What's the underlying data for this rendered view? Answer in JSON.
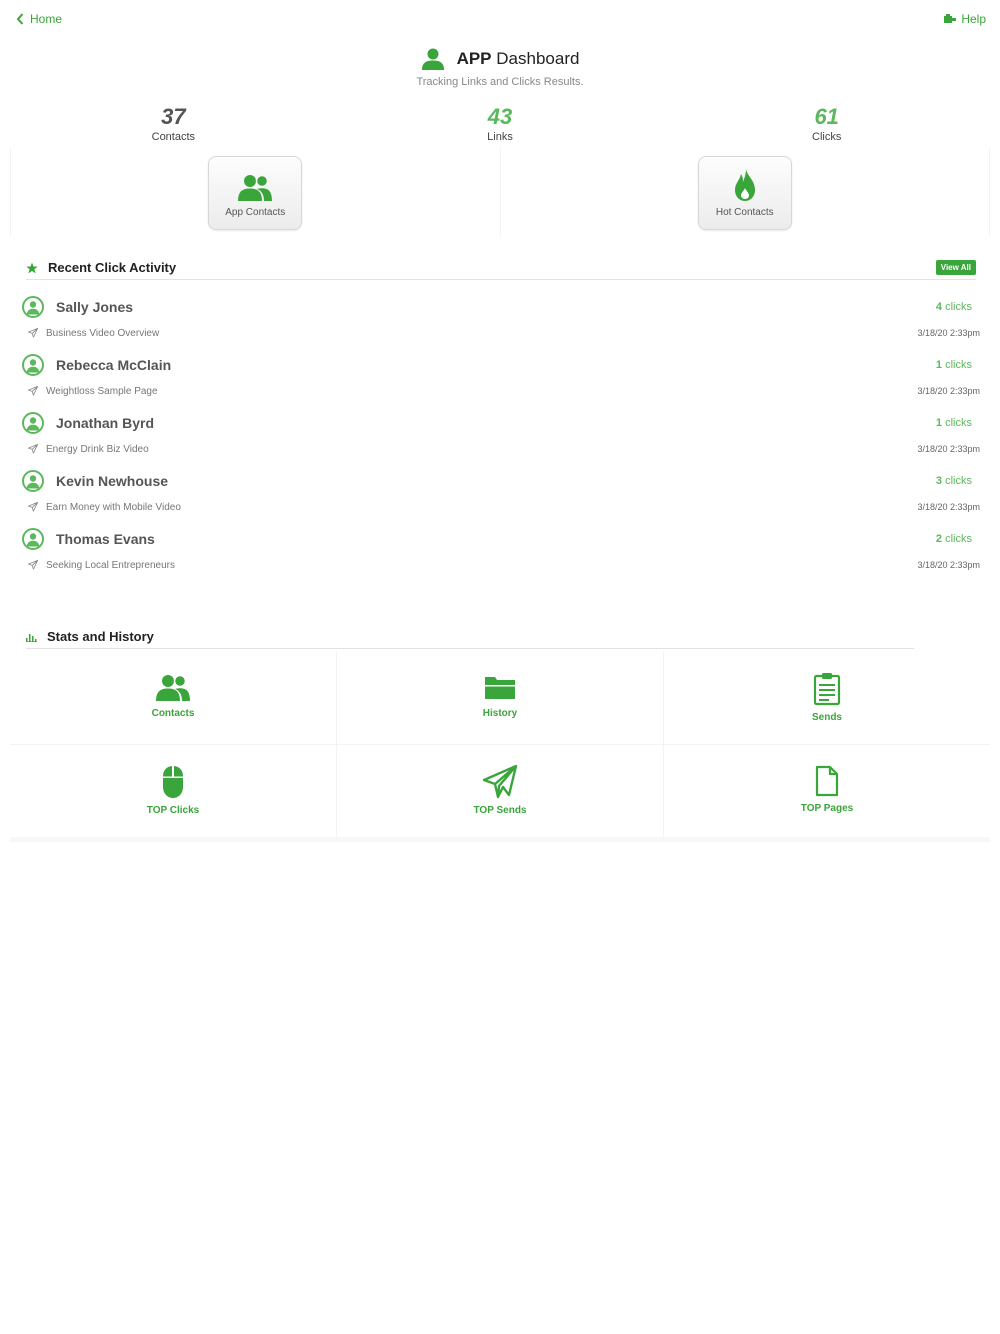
{
  "nav": {
    "back_label": "Home",
    "help_label": "Help"
  },
  "header": {
    "title_bold": "APP",
    "title_rest": "Dashboard",
    "subtitle": "Tracking Links and Clicks Results."
  },
  "counters": [
    {
      "value": "37",
      "label": "Contacts"
    },
    {
      "value": "43",
      "label": "Links"
    },
    {
      "value": "61",
      "label": "Clicks"
    }
  ],
  "actions": [
    {
      "label": "App Contacts",
      "icon": "users-icon"
    },
    {
      "label": "Hot Contacts",
      "icon": "flame-icon"
    }
  ],
  "recent": {
    "title": "Recent Click Activity",
    "view_all": "View All",
    "items": [
      {
        "name": "Sally Jones",
        "clicks": "4",
        "clicks_label": "clicks",
        "page": "Business Video Overview",
        "date": "3/18/20 2:33pm"
      },
      {
        "name": "Rebecca McClain",
        "clicks": "1",
        "clicks_label": "clicks",
        "page": "Weightloss Sample Page",
        "date": "3/18/20 2:33pm"
      },
      {
        "name": "Jonathan Byrd",
        "clicks": "1",
        "clicks_label": "clicks",
        "page": "Energy Drink Biz Video",
        "date": "3/18/20 2:33pm"
      },
      {
        "name": "Kevin Newhouse",
        "clicks": "3",
        "clicks_label": "clicks",
        "page": "Earn Money with Mobile Video",
        "date": "3/18/20 2:33pm"
      },
      {
        "name": "Thomas Evans",
        "clicks": "2",
        "clicks_label": "clicks",
        "page": "Seeking Local Entrepreneurs",
        "date": "3/18/20 2:33pm"
      }
    ]
  },
  "stats": {
    "title": "Stats and History",
    "tiles": [
      {
        "label": "Contacts",
        "icon": "users-icon"
      },
      {
        "label": "History",
        "icon": "folder-icon"
      },
      {
        "label": "Sends",
        "icon": "clipboard-icon"
      },
      {
        "label": "TOP Clicks",
        "icon": "mouse-icon"
      },
      {
        "label": "TOP Sends",
        "icon": "paper-plane-icon"
      },
      {
        "label": "TOP Pages",
        "icon": "file-icon"
      }
    ]
  },
  "colors": {
    "accent": "#3aa53a",
    "accent_light": "#5cb85c",
    "text_dark": "#222222",
    "text_muted": "#888888"
  }
}
